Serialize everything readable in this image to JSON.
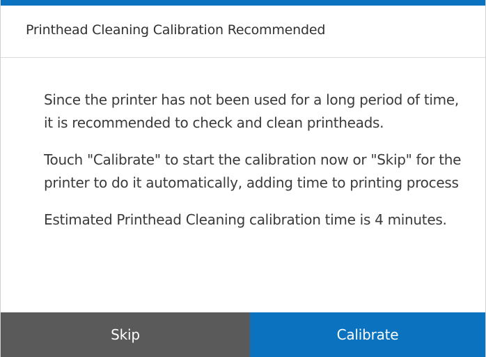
{
  "dialog": {
    "title": "Printhead Cleaning Calibration Recommended",
    "paragraphs": [
      "Since the printer has not been used for a long period of time, it is recommended to check and clean printheads.",
      "Touch \"Calibrate\" to start the calibration now or \"Skip\" for the printer to do it automatically, adding time to printing process",
      "Estimated Printhead Cleaning calibration time is 4 minutes."
    ],
    "buttons": {
      "skip_label": "Skip",
      "calibrate_label": "Calibrate"
    }
  },
  "colors": {
    "accent": "#0b72c0",
    "skip_bg": "#5a5a5a",
    "calibrate_bg": "#0b72c0"
  }
}
